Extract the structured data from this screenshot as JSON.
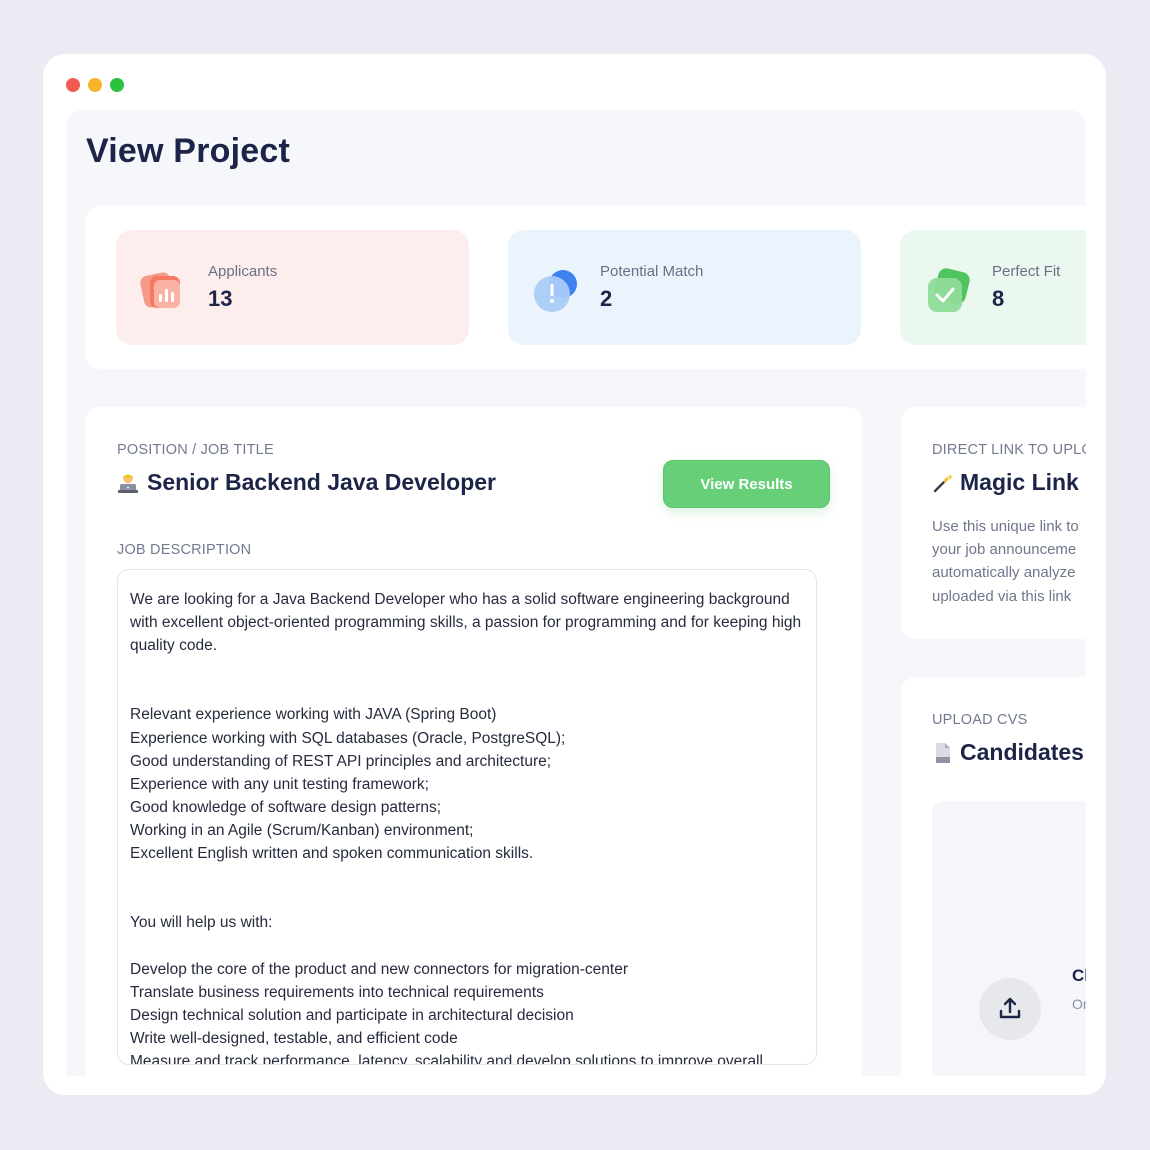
{
  "page": {
    "title": "View Project"
  },
  "stats": [
    {
      "label": "Applicants",
      "value": "13",
      "icon": "chart-folder-icon",
      "color": "#f3755e"
    },
    {
      "label": "Potential Match",
      "value": "2",
      "icon": "alert-bubble-icon",
      "color": "#4a8cf0"
    },
    {
      "label": "Perfect Fit",
      "value": "8",
      "icon": "check-shield-icon",
      "color": "#5ccf6c"
    }
  ],
  "job": {
    "caption": "POSITION / JOB TITLE",
    "title": "Senior Backend Java Developer",
    "view_results_label": "View Results",
    "description_caption": "JOB DESCRIPTION",
    "description": {
      "intro": "We are looking for a Java Backend Developer who has a solid software engineering background with excellent object-oriented programming skills, a passion for programming and for keeping high quality code.",
      "requirements": [
        "Relevant experience working with JAVA (Spring Boot)",
        "Experience working with SQL databases (Oracle, PostgreSQL);",
        "Good understanding of REST API principles and architecture;",
        "Experience with any unit testing framework;",
        "Good knowledge of software design patterns;",
        "Working in an Agile (Scrum/Kanban) environment;",
        "Excellent English written and spoken communication skills."
      ],
      "help_heading": "You will help us with:",
      "responsibilities": [
        "Develop the core of the product and new connectors for migration-center",
        "Translate business requirements into technical requirements",
        "Design technical solution and participate in architectural decision",
        "Write well-designed, testable, and efficient code",
        "Measure and track performance, latency, scalability and develop solutions to improve overall"
      ]
    }
  },
  "magic_link": {
    "caption": "DIRECT LINK TO UPLOA",
    "title": "Magic Link",
    "text_lines": [
      "Use this unique link to",
      "your job announceme",
      "automatically analyze",
      "uploaded via this link"
    ]
  },
  "candidates": {
    "caption": "UPLOAD CVS",
    "title": "Candidates",
    "upload_text_a": "Cl",
    "upload_text_b": "Or"
  }
}
